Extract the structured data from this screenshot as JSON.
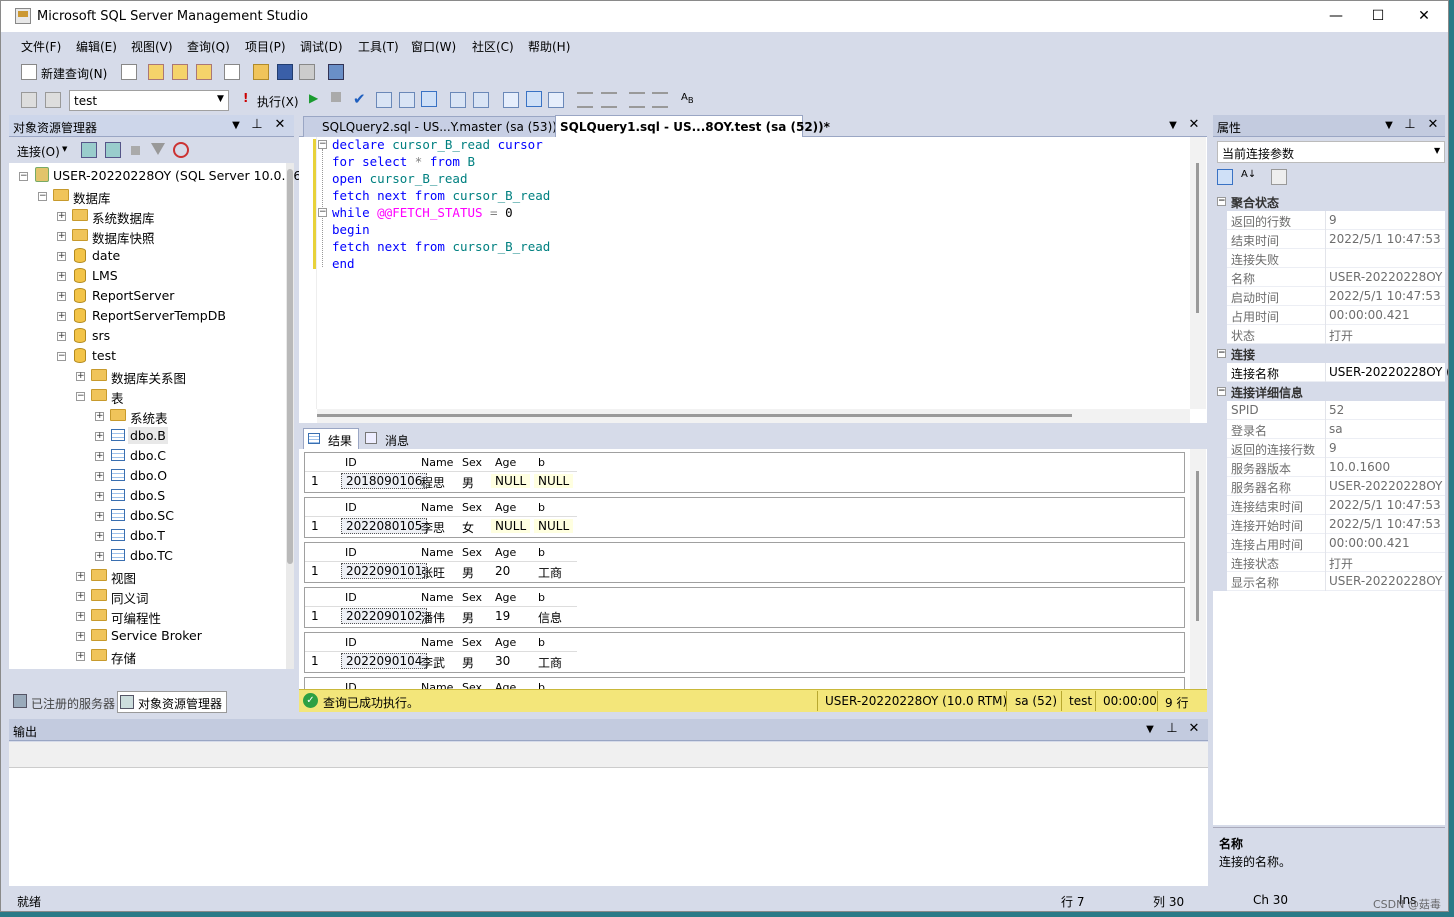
{
  "app": {
    "title": "Microsoft SQL Server Management Studio"
  },
  "menu": [
    "文件(F)",
    "编辑(E)",
    "视图(V)",
    "查询(Q)",
    "项目(P)",
    "调试(D)",
    "工具(T)",
    "窗口(W)",
    "社区(C)",
    "帮助(H)"
  ],
  "toolbar": {
    "new_query": "新建查询(N)",
    "database": "test",
    "execute": "执行(X)"
  },
  "object_explorer": {
    "title": "对象资源管理器",
    "connect": "连接(O)",
    "server": "USER-20220228OY (SQL Server 10.0.16",
    "databases": "数据库",
    "items": [
      "系统数据库",
      "数据库快照",
      "date",
      "LMS",
      "ReportServer",
      "ReportServerTempDB",
      "srs",
      "test"
    ],
    "test_children": [
      "数据库关系图",
      "表"
    ],
    "tables": [
      "系统表",
      "dbo.B",
      "dbo.C",
      "dbo.O",
      "dbo.S",
      "dbo.SC",
      "dbo.T",
      "dbo.TC"
    ],
    "more": [
      "视图",
      "同义词",
      "可编程性",
      "Service Broker",
      "存储"
    ],
    "bottom_tabs": [
      "已注册的服务器",
      "对象资源管理器"
    ]
  },
  "editor": {
    "tabs": [
      "SQLQuery2.sql - US...Y.master (sa (53))",
      "SQLQuery1.sql - US...8OY.test (sa (52))*"
    ],
    "lines": [
      [
        "declare ",
        "cursor_B_read ",
        "cursor"
      ],
      [
        "for ",
        "select ",
        "* ",
        "from ",
        "B"
      ],
      [
        "open ",
        "cursor_B_read"
      ],
      [
        "fetch ",
        "next ",
        "from ",
        "cursor_B_read"
      ],
      [
        "while ",
        "@@FETCH_STATUS ",
        "= ",
        "0"
      ],
      [
        "begin"
      ],
      [
        "fetch ",
        "next ",
        "from ",
        "cursor_B_read"
      ],
      [
        "end"
      ]
    ]
  },
  "results": {
    "tabs": [
      "结果",
      "消息"
    ],
    "headers": [
      "ID",
      "Name",
      "Sex",
      "Age",
      "b"
    ],
    "rows": [
      {
        "n": "1",
        "ID": "2018090106",
        "Name": "程思",
        "Sex": "男",
        "Age": "NULL",
        "b": "NULL"
      },
      {
        "n": "1",
        "ID": "2022080105",
        "Name": "李思",
        "Sex": "女",
        "Age": "NULL",
        "b": "NULL"
      },
      {
        "n": "1",
        "ID": "2022090101",
        "Name": "张旺",
        "Sex": "男",
        "Age": "20",
        "b": "工商"
      },
      {
        "n": "1",
        "ID": "2022090102",
        "Name": "潘伟",
        "Sex": "男",
        "Age": "19",
        "b": "信息"
      },
      {
        "n": "1",
        "ID": "2022090104",
        "Name": "李武",
        "Sex": "男",
        "Age": "30",
        "b": "工商"
      }
    ]
  },
  "query_status": {
    "message": "查询已成功执行。",
    "server": "USER-20220228OY (10.0 RTM)",
    "user": "sa (52)",
    "db": "test",
    "time": "00:00:00",
    "rows": "9 行"
  },
  "properties": {
    "title": "属性",
    "selector": "当前连接参数",
    "groups": [
      {
        "name": "聚合状态",
        "items": [
          [
            "返回的行数",
            "9"
          ],
          [
            "结束时间",
            "2022/5/1 10:47:53"
          ],
          [
            "连接失败",
            ""
          ],
          [
            "名称",
            "USER-20220228OY"
          ],
          [
            "启动时间",
            "2022/5/1 10:47:53"
          ],
          [
            "占用时间",
            "00:00:00.421"
          ],
          [
            "状态",
            "打开"
          ]
        ]
      },
      {
        "name": "连接",
        "items": [
          [
            "连接名称",
            "USER-20220228OY ("
          ]
        ]
      },
      {
        "name": "连接详细信息",
        "items": [
          [
            "SPID",
            "52"
          ],
          [
            "登录名",
            "sa"
          ],
          [
            "返回的连接行数",
            "9"
          ],
          [
            "服务器版本",
            "10.0.1600"
          ],
          [
            "服务器名称",
            "USER-20220228OY"
          ],
          [
            "连接结束时间",
            "2022/5/1 10:47:53"
          ],
          [
            "连接开始时间",
            "2022/5/1 10:47:53"
          ],
          [
            "连接占用时间",
            "00:00:00.421"
          ],
          [
            "连接状态",
            "打开"
          ],
          [
            "显示名称",
            "USER-20220228OY"
          ]
        ]
      }
    ],
    "desc_title": "名称",
    "desc_text": "连接的名称。"
  },
  "output": {
    "title": "输出"
  },
  "statusbar": {
    "left": "就绪",
    "row": "行 7",
    "col": "列 30",
    "ch": "Ch 30",
    "ins": "Ins"
  },
  "watermark": "CSDN @菇毒"
}
